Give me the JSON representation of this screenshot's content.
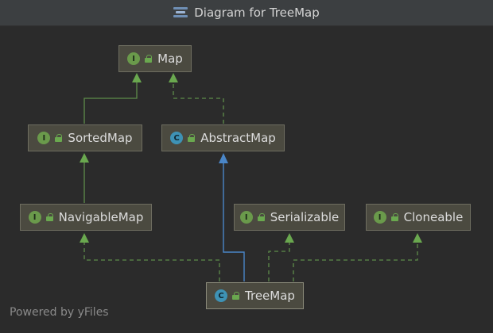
{
  "window": {
    "title": "Diagram for TreeMap",
    "title_icon": "diagram-icon"
  },
  "nodes": {
    "map": {
      "label": "Map",
      "kind": "I"
    },
    "sortedmap": {
      "label": "SortedMap",
      "kind": "I"
    },
    "abstractmap": {
      "label": "AbstractMap",
      "kind": "C"
    },
    "navigablemap": {
      "label": "NavigableMap",
      "kind": "I"
    },
    "serializable": {
      "label": "Serializable",
      "kind": "I"
    },
    "cloneable": {
      "label": "Cloneable",
      "kind": "I"
    },
    "treemap": {
      "label": "TreeMap",
      "kind": "C"
    }
  },
  "footer": {
    "text": "Powered by yFiles"
  },
  "colors": {
    "background": "#2b2b2b",
    "titlebar": "#3c3f41",
    "node_fill": "#4b4a40",
    "interface_edge": "#5e8c4a",
    "class_edge": "#4a86c8"
  }
}
